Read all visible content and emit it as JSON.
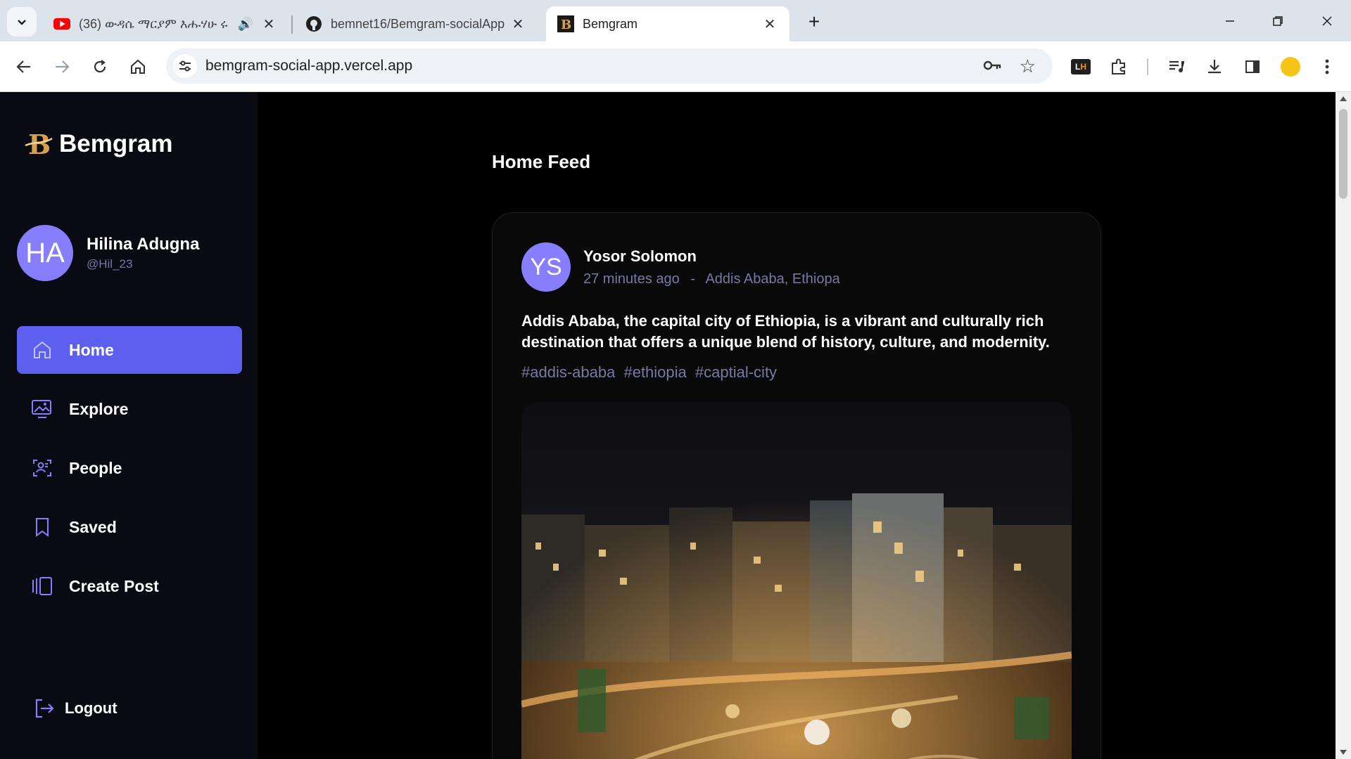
{
  "browser": {
    "tabs": [
      {
        "title": "(36) ውዳሴ ማርያም እሑሃሁ ሩ",
        "favicon": "youtube-icon"
      },
      {
        "title": "bemnet16/Bemgram-socialApp",
        "favicon": "github-icon"
      },
      {
        "title": "Bemgram",
        "favicon": "bemgram-icon"
      }
    ],
    "url": "bemgram-social-app.vercel.app",
    "extension_lh": {
      "l": "L",
      "h": "H"
    }
  },
  "app": {
    "brand": "Bemgram",
    "user": {
      "initials": "HA",
      "name": "Hilina Adugna",
      "handle": "@Hil_23"
    },
    "nav": [
      {
        "label": "Home",
        "icon": "home-icon",
        "active": true
      },
      {
        "label": "Explore",
        "icon": "gallery-icon"
      },
      {
        "label": "People",
        "icon": "people-icon"
      },
      {
        "label": "Saved",
        "icon": "bookmark-icon"
      },
      {
        "label": "Create Post",
        "icon": "create-post-icon"
      }
    ],
    "logout": "Logout",
    "feed_title": "Home Feed",
    "post": {
      "initials": "YS",
      "author": "Yosor Solomon",
      "time": "27 minutes ago",
      "separator": "-",
      "location": "Addis Ababa, Ethiopa",
      "text": "Addis Ababa, the capital city of Ethiopia, is a vibrant and culturally rich destination that offers a unique blend of history, culture, and modernity.",
      "tags": [
        "#addis-ababa",
        "#ethiopia",
        "#captial-city"
      ]
    }
  },
  "colors": {
    "accent": "#5d5fef",
    "avatar": "#877eff",
    "muted": "#7878a3"
  }
}
